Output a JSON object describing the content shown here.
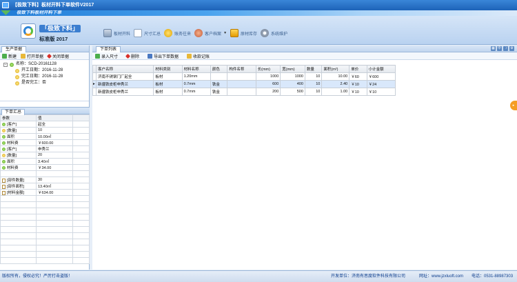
{
  "window": {
    "title": "【极致下料】板材开料下单软件V2017"
  },
  "banner": {
    "slogan": "极致下料板材开料下单"
  },
  "brand": {
    "name": "「极致下料」",
    "edition": "标准版 2017"
  },
  "toolbar": {
    "items": [
      {
        "label": "板材开料",
        "icon": "board-icon"
      },
      {
        "label": "尺寸汇总",
        "icon": "document-icon"
      },
      {
        "label": "账务往来",
        "icon": "coins-icon"
      },
      {
        "label": "客户档案",
        "icon": "users-icon",
        "dropdown": true
      },
      {
        "label": "原材库存",
        "icon": "stock-icon"
      },
      {
        "label": "系统维护",
        "icon": "gear-icon"
      }
    ]
  },
  "left": {
    "tab": "生产单据",
    "actions": [
      "新建",
      "打开单据",
      "关闭单据"
    ],
    "tree": {
      "name": "名称：SCD-20161128",
      "start": "开工日期：2016-11-28",
      "finish": "完工日期：2016-11-28",
      "done": "是否完工：否"
    }
  },
  "summary": {
    "tab": "下单汇总",
    "headers": [
      "参数",
      "值"
    ],
    "rows": [
      {
        "param": "[客户]",
        "value": "起全",
        "icon": "green"
      },
      {
        "param": "[数量]",
        "value": "10",
        "icon": "yellow"
      },
      {
        "param": "面积",
        "value": "10.00㎡",
        "icon": "green"
      },
      {
        "param": "材料费",
        "value": "￥600.00",
        "icon": "green"
      },
      {
        "param": "[客户]",
        "value": "申秀兰",
        "icon": "green"
      },
      {
        "param": "[数量]",
        "value": "20",
        "icon": "yellow"
      },
      {
        "param": "面积",
        "value": "3.40㎡",
        "icon": "green"
      },
      {
        "param": "材料费",
        "value": "￥34.00",
        "icon": "green"
      },
      {
        "param": "",
        "value": "",
        "icon": ""
      },
      {
        "param": "[部件数量]",
        "value": "30",
        "icon": "doc"
      },
      {
        "param": "[部件面积]",
        "value": "13.40㎡",
        "icon": "doc"
      },
      {
        "param": "[材料金额]",
        "value": "￥634.00",
        "icon": "doc"
      }
    ]
  },
  "main": {
    "tab": "下单列表",
    "tools": [
      "中",
      "☽",
      "⚙"
    ],
    "actions": [
      "录入尺寸",
      "删除",
      "导出下单数据",
      "收款记账"
    ],
    "headers": [
      "客户名称",
      "材料类别",
      "材料名称",
      "颜色",
      "构件名称",
      "长(mm)",
      "宽(mm)",
      "数量",
      "面积(m²)",
      "单价",
      "小计金额"
    ],
    "rows": [
      [
        "济南不锈钢门厂起全",
        "板材",
        "1.20mm",
        "",
        "",
        "1000",
        "1000",
        "10",
        "10.00",
        "￥60",
        "￥600"
      ],
      [
        "新疆铁皮柜申秀兰",
        "板材",
        "0.7mm",
        "铁金",
        "",
        "600",
        "400",
        "10",
        "2.40",
        "￥10",
        "￥24"
      ],
      [
        "新疆铁皮柜申秀兰",
        "板材",
        "0.7mm",
        "铁金",
        "",
        "200",
        "500",
        "10",
        "1.00",
        "￥10",
        "￥10"
      ]
    ]
  },
  "status": {
    "left": "版权所有，侵权必究！严厉打击盗版！",
    "developer": "开发单位：济南有思度软件科技有限公司",
    "site": "网址：www.jzxluoft.com",
    "phone": "电话：0531-88987303"
  }
}
